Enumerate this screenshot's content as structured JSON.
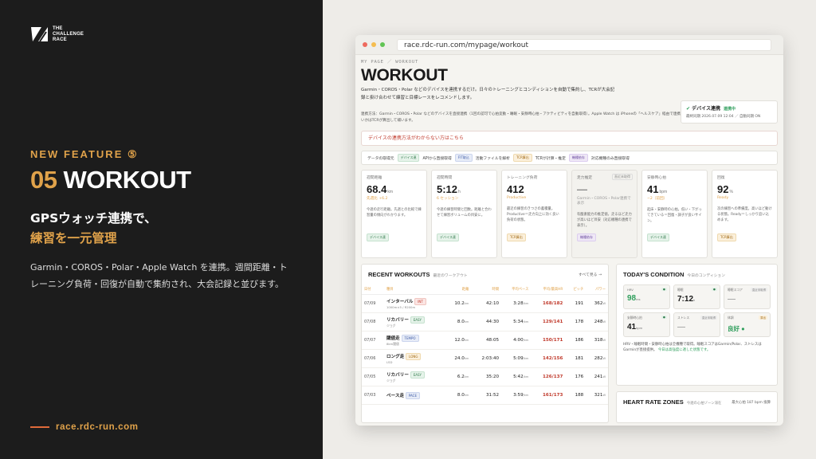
{
  "brand": {
    "logo_text": [
      "THE",
      "CHALLENGE",
      "RACE"
    ]
  },
  "feature": {
    "kicker": "NEW FEATURE ⑤",
    "number": "05",
    "title": "WORKOUT",
    "subtitle_line1": "GPSウォッチ連携で、",
    "subtitle_line2": "練習を一元管理",
    "description": "Garmin・COROS・Polar・Apple Watch を連携。週間距離・トレーニング負荷・回復が自動で集約され、大会記録と並びます。",
    "site_url": "race.rdc-run.com"
  },
  "browser": {
    "url": "race.rdc-run.com/mypage/workout"
  },
  "page": {
    "breadcrumb": "MY PAGE ／ WORKOUT",
    "title": "WORKOUT",
    "description": "Garmin・COROS・Polar などのデバイスを連携するだけ。日々のトレーニングとコンディションを自動で集約し、TCRが大会記録と掛け合わせて練習と目標レースをレコメンドします。",
    "note": "連携方法：Garmin・COROS・Polar などのデバイスを直接連携（1回の認可で心拍変動・睡眠・安静時心拍・アクティビティを自動取得）。Apple Watch は iPhoneの「ヘルスケア」経由で連携。連携するデバイスによって取れる指標が変わり、足りないかはTCRが算出して補います。",
    "help_link": "デバイスの連携方法がわからない方はこちら"
  },
  "sync": {
    "title": "デバイス連携",
    "status": "連携中",
    "detail": "最終同期 2026.07.09 12:04 ／ 自動同期 ON"
  },
  "sources": {
    "label": "データの取得元",
    "items": [
      {
        "tag": "デバイス連",
        "text": "APIから直接取得"
      },
      {
        "tag": "FIT取込",
        "text": "活動ファイルを解析"
      },
      {
        "tag": "TCR算出",
        "text": "TCRが計算・推定"
      },
      {
        "tag": "機種依存",
        "text": "対応機種のみ直接取得"
      }
    ]
  },
  "metrics": [
    {
      "label": "週間距離",
      "value": "68.4",
      "unit": "km",
      "sub": "先週比 +6.2",
      "text": "今週の走行距離。先週との比較で練習量の傾向がわかります。",
      "tag": "デバイス連"
    },
    {
      "label": "週間時間",
      "value": "5:12",
      "unit": "h",
      "sub": "6 セッション",
      "text": "今週の練習時間と回数。距離と合わせて練習ボリュームの目安に。",
      "tag": "デバイス連"
    },
    {
      "label": "トレーニング負荷",
      "value": "412",
      "unit": "",
      "sub": "Productive",
      "text": "最近の練習のきつさの蓄積量。Productive＝走力向上に効く良い負荷の状態。",
      "tag": "TCR算出"
    },
    {
      "label": "走力推定",
      "value": "—",
      "unit": "",
      "sub": "Garmin・COROS・Polar連携で表示",
      "text": "有酸素能力の推定値。走るほど走力が高いほど目安（対応機種の連携で表示）。",
      "tag": "機種依存",
      "corner": "直近未取得"
    },
    {
      "label": "安静時心拍",
      "value": "41",
      "unit": "bpm",
      "sub": "−2（前回）",
      "text": "起床・安静時の心拍。低い・下がってきている＝回復・調子が良いサイン。",
      "tag": "デバイス連"
    },
    {
      "label": "回復",
      "value": "92",
      "unit": "%",
      "sub": "Ready",
      "text": "次の練習への準備度。高いほど動ける状態。Ready＝しっかり追い込めます。",
      "tag": "TCR算出"
    }
  ],
  "workouts": {
    "title": "RECENT WORKOUTS",
    "subtitle": "最近のワークアウト",
    "more": "すべて見る →",
    "columns": [
      "日付",
      "種目",
      "距離",
      "時間",
      "平均ペース",
      "平均/最高HR",
      "ピッチ",
      "パワー"
    ],
    "rows": [
      {
        "date": "07/09",
        "name": "インターバル",
        "tag": "INT",
        "detail": "1000m×5 / R200m",
        "dist": "10.2",
        "time": "42:10",
        "pace": "3:28",
        "hr": "168/182",
        "cad": "191",
        "pow": "362"
      },
      {
        "date": "07/08",
        "name": "リカバリー",
        "tag": "EASY",
        "detail": "ジョグ",
        "dist": "8.0",
        "time": "44:30",
        "pace": "5:34",
        "hr": "129/141",
        "cad": "178",
        "pow": "248"
      },
      {
        "date": "07/07",
        "name": "閾値走",
        "tag": "TEMPO",
        "detail": "8km閾値",
        "dist": "12.0",
        "time": "48:05",
        "pace": "4:00",
        "hr": "150/171",
        "cad": "186",
        "pow": "318"
      },
      {
        "date": "07/06",
        "name": "ロング走",
        "tag": "LONG",
        "detail": "LSD",
        "dist": "24.0",
        "time": "2:03:40",
        "pace": "5:09",
        "hr": "142/156",
        "cad": "181",
        "pow": "282"
      },
      {
        "date": "07/05",
        "name": "リカバリー",
        "tag": "EASY",
        "detail": "ジョグ",
        "dist": "6.2",
        "time": "35:20",
        "pace": "5:42",
        "hr": "126/137",
        "cad": "176",
        "pow": "241"
      },
      {
        "date": "07/03",
        "name": "ペース走",
        "tag": "PACE",
        "detail": "",
        "dist": "8.0",
        "time": "31:52",
        "pace": "3:59",
        "hr": "161/173",
        "cad": "188",
        "pow": "321"
      }
    ]
  },
  "condition": {
    "title": "TODAY'S CONDITION",
    "subtitle": "今日のコンディション",
    "cells": [
      {
        "label": "HRV",
        "value": "98",
        "unit": "ms",
        "badge": "●",
        "green": true
      },
      {
        "label": "睡眠",
        "value": "7:12",
        "unit": "h",
        "badge": "●"
      },
      {
        "label": "睡眠スコア",
        "value": "—",
        "unit": "",
        "badge": "直近未取得",
        "muted": true
      },
      {
        "label": "安静時心拍",
        "value": "41",
        "unit": "bpm",
        "badge": "●"
      },
      {
        "label": "ストレス",
        "value": "—",
        "unit": "",
        "badge": "直近未取得",
        "muted": true
      },
      {
        "label": "体調",
        "value": "良好 ●",
        "unit": "",
        "badge": "算出",
        "orange": true,
        "green": true
      }
    ],
    "text": "HRV・睡眠時間・安静時心拍は全機種で取得。睡眠スコアはGarmin/Polar、ストレスはGarminが直接提供。",
    "highlight": "今日は高強度に適した状態です。"
  },
  "hr_zones": {
    "title": "HEART RATE ZONES",
    "subtitle": "今週の心拍ゾーン滞在",
    "right": "最大心拍 187 bpm 換算"
  },
  "colors": {
    "accent": "#e0a24a",
    "dark": "#1c1c1c",
    "hr_red": "#c0392b",
    "green": "#2f9e5c"
  }
}
